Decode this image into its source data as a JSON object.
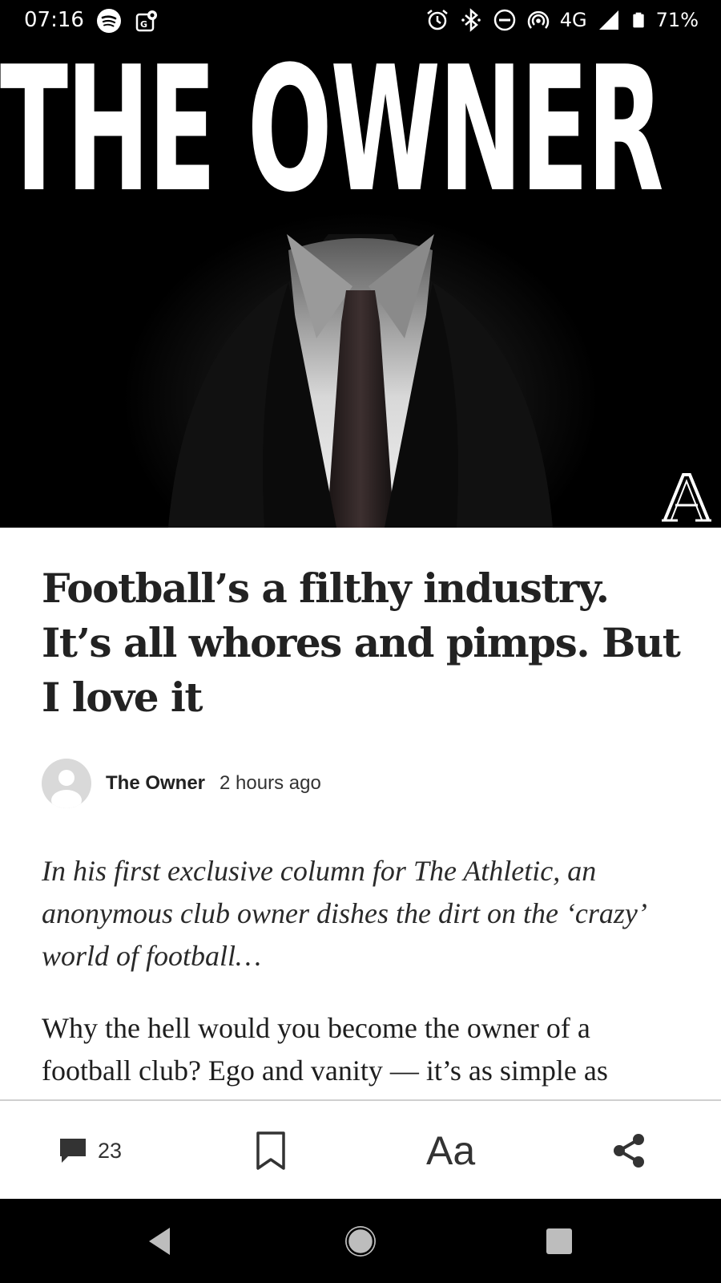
{
  "status_bar": {
    "time": "07:16",
    "network": "4G",
    "battery": "71%",
    "left_icons": [
      "spotify-icon",
      "maps-icon"
    ],
    "right_icons": [
      "alarm-icon",
      "bluetooth-icon",
      "do-not-disturb-icon",
      "hotspot-icon",
      "signal-icon",
      "battery-icon"
    ]
  },
  "hero": {
    "title": "THE OWNER",
    "logo_letter": "A"
  },
  "article": {
    "headline": "Football’s a filthy industry. It’s all whores and pimps. But I love it",
    "author": "The Owner",
    "published": "2 hours ago",
    "standfirst": "In his first exclusive column for The Athletic, an anonymous club owner dishes the dirt on the ‘crazy’ world of football…",
    "body": "Why the hell would you become the owner of a football club? Ego and vanity — it’s as simple as"
  },
  "action_bar": {
    "comment_count": "23",
    "text_size_label": "Aa"
  },
  "colors": {
    "background": "#000000",
    "surface": "#ffffff",
    "headline": "#222222",
    "divider": "#cfcfcf"
  }
}
